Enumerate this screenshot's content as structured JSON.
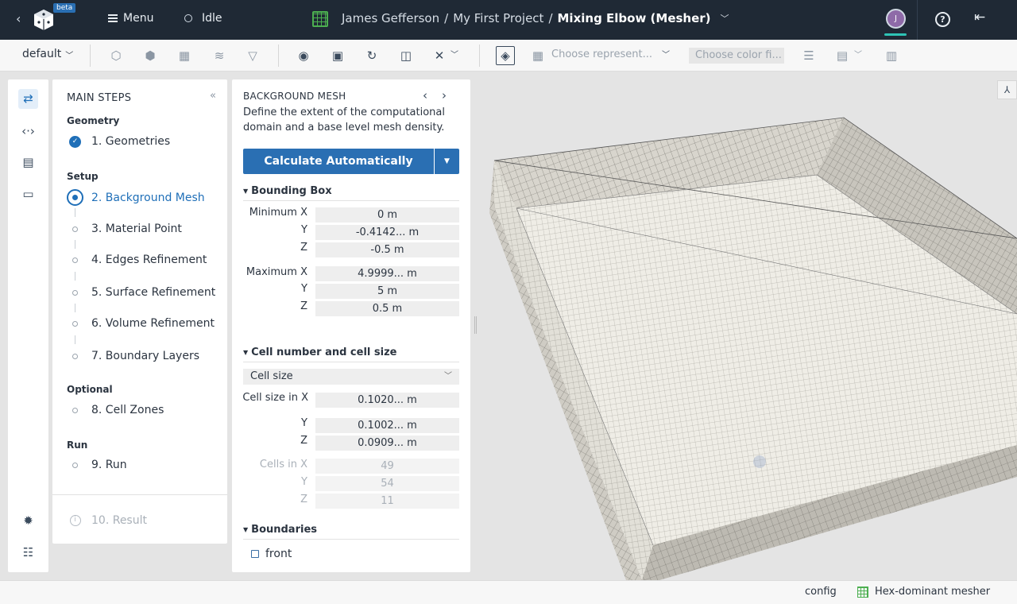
{
  "topbar": {
    "logo_badge": "beta",
    "menu_label": "Menu",
    "status_label": "Idle",
    "breadcrumb": {
      "user": "James Gefferson",
      "sep1": "/",
      "project": "My First Project",
      "sep2": "/",
      "current": "Mixing Elbow (Mesher)"
    },
    "avatar_initial": "J",
    "help_glyph": "?"
  },
  "toolbar": {
    "view_select": "default",
    "representation_placeholder": "Choose represent...",
    "color_placeholder": "Choose color fi..."
  },
  "steps": {
    "title": "MAIN STEPS",
    "groups": [
      {
        "label": "Geometry"
      },
      {
        "label": "Setup"
      },
      {
        "label": "Optional"
      },
      {
        "label": "Run"
      }
    ],
    "items": [
      {
        "label": "1. Geometries",
        "state": "done"
      },
      {
        "label": "2. Background Mesh",
        "state": "current"
      },
      {
        "label": "3. Material Point",
        "state": "todo"
      },
      {
        "label": "4. Edges Refinement",
        "state": "todo"
      },
      {
        "label": "5. Surface Refinement",
        "state": "todo"
      },
      {
        "label": "6. Volume Refinement",
        "state": "todo"
      },
      {
        "label": "7. Boundary Layers",
        "state": "todo"
      },
      {
        "label": "8. Cell Zones",
        "state": "todo"
      },
      {
        "label": "9. Run",
        "state": "todo"
      },
      {
        "label": "10. Result",
        "state": "disabled"
      }
    ]
  },
  "panel": {
    "title": "BACKGROUND MESH",
    "description": "Define the extent of the computational domain and a base level mesh density.",
    "calc_button": "Calculate Automatically",
    "bounding_box": {
      "title": "Bounding Box",
      "min_label": "Minimum X",
      "max_label": "Maximum X",
      "y_label": "Y",
      "z_label": "Z",
      "min_x": "0 m",
      "min_y": "-0.4142... m",
      "min_z": "-0.5 m",
      "max_x": "4.9999... m",
      "max_y": "5 m",
      "max_z": "0.5 m"
    },
    "cells": {
      "title": "Cell number and cell size",
      "mode": "Cell size",
      "size_label": "Cell size in X",
      "size_x": "0.1020... m",
      "size_y": "0.1002... m",
      "size_z": "0.0909... m",
      "count_label": "Cells in X",
      "count_x": "49",
      "count_y": "54",
      "count_z": "11"
    },
    "boundaries": {
      "title": "Boundaries",
      "first": "front"
    }
  },
  "footer": {
    "config": "config",
    "mesher": "Hex-dominant mesher"
  },
  "colors": {
    "topbar": "#1f2935",
    "accent": "#2a6fb3",
    "mesh_face": "#efede6",
    "mesh_line": "#5a5a5a"
  },
  "icons": [
    "chevron-left-icon",
    "app-logo-icon",
    "hamburger-icon",
    "status-circle-icon",
    "project-mesh-icon",
    "chevron-down-icon",
    "help-icon",
    "logout-icon",
    "collapse-icon",
    "workflow-icon",
    "code-icon",
    "storage-icon",
    "console-icon",
    "bug-icon",
    "list-icon",
    "triad-icon"
  ]
}
